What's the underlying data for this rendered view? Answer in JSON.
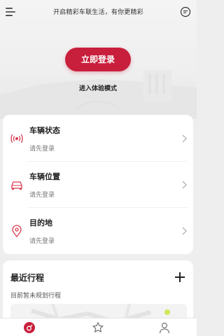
{
  "header": {
    "title": "开启精彩车联生活，有你更精彩",
    "menu_icon": "menu-icon",
    "message_icon": "message-icon"
  },
  "login": {
    "button_label": "立即登录",
    "trial_label": "进入体验模式"
  },
  "vehicle_card": {
    "items": [
      {
        "title": "车辆状态",
        "subtitle": "请先登录",
        "icon": "vehicle-signal-icon"
      },
      {
        "title": "车辆位置",
        "subtitle": "请先登录",
        "icon": "car-icon"
      },
      {
        "title": "目的地",
        "subtitle": "请先登录",
        "icon": "location-pin-icon"
      }
    ]
  },
  "trips": {
    "title": "最近行程",
    "subtitle": "目前暂未规划行程",
    "add_icon": "plus-icon"
  },
  "nav": {
    "items": [
      {
        "name": "home",
        "icon": "home-icon",
        "active": true
      },
      {
        "name": "favorites",
        "icon": "star-icon",
        "active": false
      },
      {
        "name": "profile",
        "icon": "person-icon",
        "active": false
      }
    ]
  },
  "colors": {
    "accent": "#c81f3c",
    "icon_accent": "#d9394f",
    "background": "#eeeeee",
    "card": "#ffffff"
  }
}
